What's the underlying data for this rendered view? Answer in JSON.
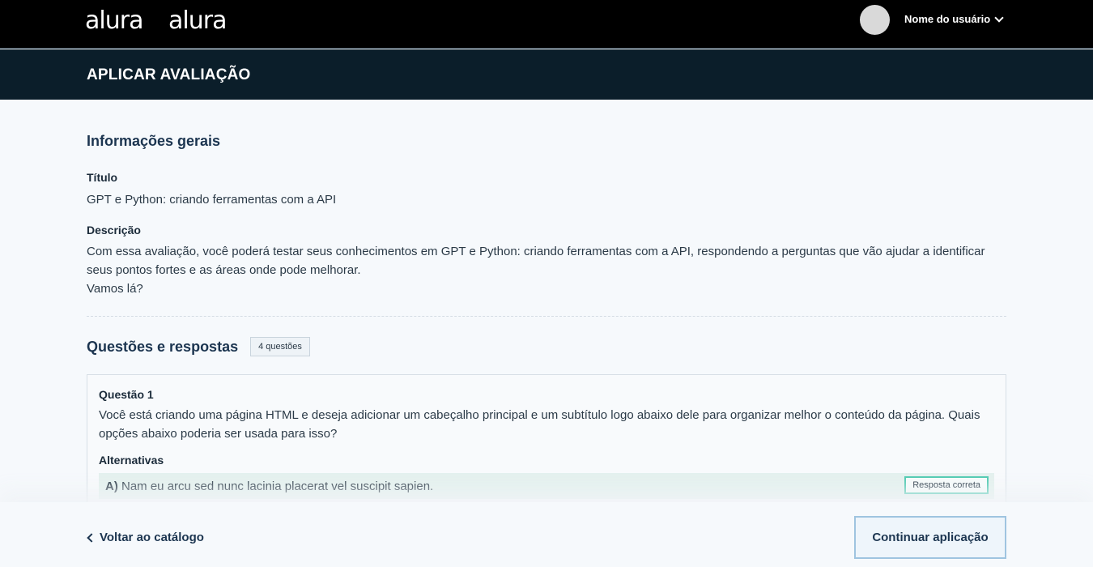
{
  "header": {
    "logo_primary": "alura",
    "logo_secondary": "alura",
    "user_name": "Nome do usuário"
  },
  "page": {
    "title": "APLICAR AVALIAÇÃO"
  },
  "info": {
    "section_title": "Informações gerais",
    "titulo_label": "Título",
    "titulo_value": "GPT e Python: criando ferramentas com a API",
    "descricao_label": "Descrição",
    "descricao_line1": "Com essa avaliação, você poderá testar seus conhecimentos em GPT e Python: criando ferramentas com a API, respondendo a perguntas que vão ajudar a identificar seus pontos fortes e as áreas onde pode melhorar.",
    "descricao_line2": "Vamos lá?"
  },
  "questions": {
    "section_title": "Questões e respostas",
    "count_badge": "4 questões",
    "items": [
      {
        "label": "Questão 1",
        "text": "Você está criando uma página HTML e deseja adicionar um cabeçalho principal e um subtítulo logo abaixo dele para organizar melhor o conteúdo da página. Quais opções abaixo poderia ser usada para isso?",
        "alternatives_label": "Alternativas",
        "alternatives": [
          {
            "letter": "A)",
            "text": "Nam eu arcu sed nunc lacinia placerat vel suscipit sapien.",
            "badge": "Resposta correta"
          }
        ]
      }
    ]
  },
  "footer": {
    "back_label": "Voltar ao catálogo",
    "continue_label": "Continuar aplicação"
  },
  "colors": {
    "topbar": "#000000",
    "titlebar": "#0b1e2a",
    "heading": "#1c3550",
    "correct_accent": "#4cc9b0",
    "correct_row_bg": "#e4f1ee"
  }
}
